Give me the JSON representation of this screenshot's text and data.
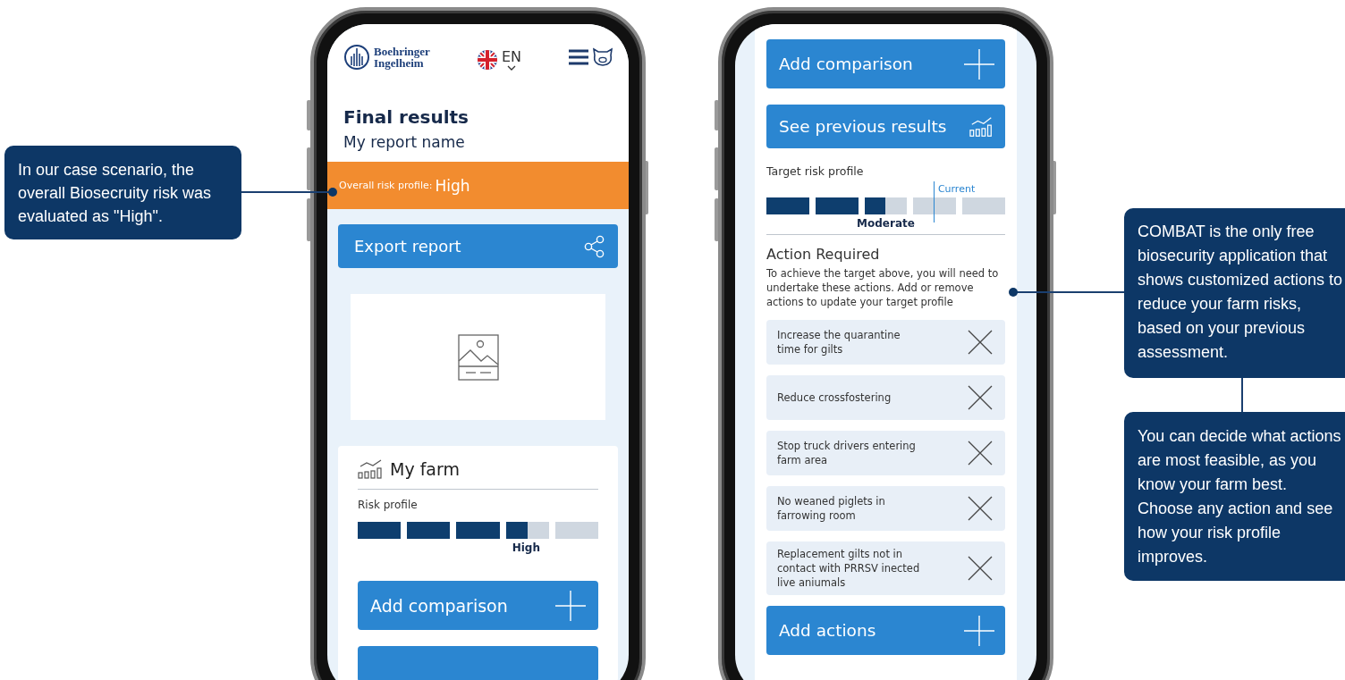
{
  "callouts": [
    {
      "text": "In our case scenario, the overall Biosecruity risk was evaluated as \"High\"."
    },
    {
      "text": "COMBAT is the only free biosecurity application that shows customized actions to reduce your farm risks, based on your previous assessment."
    },
    {
      "text": "You can decide what actions are most feasible, as you know your farm best. Choose any action and see how your risk profile improves."
    }
  ],
  "results_screen": {
    "header": {
      "logo_lines": [
        "Boehringer",
        "Ingelheim"
      ],
      "language": "EN"
    },
    "title": "Final results",
    "subtitle": "My report name",
    "risk_banner": {
      "label": "Overall risk profile:",
      "value": "High"
    },
    "export_button": "Export report",
    "farm_card": {
      "title": "My farm",
      "risk_label": "Risk profile",
      "level": 0.7,
      "level_label": "High"
    },
    "add_button": "Add comparison"
  },
  "actions_screen": {
    "buttons": [
      {
        "label": "Add comparison",
        "kind": "add"
      },
      {
        "label": "See previous results",
        "kind": "history"
      }
    ],
    "target": {
      "label": "Target risk profile",
      "level": 0.5,
      "level_label": "Moderate",
      "current_marker": {
        "label": "Current",
        "level": 0.7
      }
    },
    "action_required": {
      "title": "Action Required",
      "description": "To achieve the target above, you will need to undertake these actions. Add or remove actions to update your target profile"
    },
    "actions": [
      "Increase the quarantine time for gilts",
      "Reduce crossfostering",
      "Stop truck drivers entering farm area",
      "No weaned piglets in farrowing room",
      "Replacement gilts not in contact with PRRSV inected live aniumals"
    ],
    "add_button": {
      "label": "Add actions",
      "kind": "add"
    }
  }
}
